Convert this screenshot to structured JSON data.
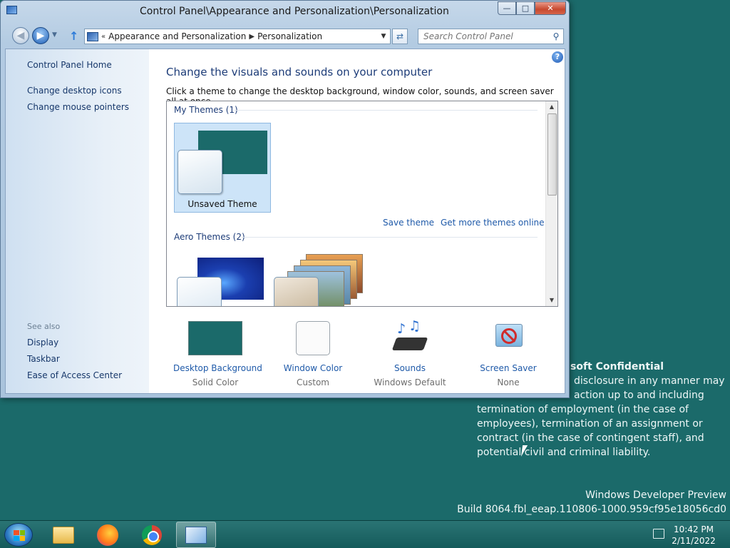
{
  "desktop": {
    "confidential_title": "soft Confidential",
    "confidential_lines": [
      "disclosure in any manner may",
      "action up to and including",
      "termination of employment (in the case of",
      "employees), termination of an assignment or",
      "contract (in the case of contingent staff), and",
      "potential civil and criminal liability."
    ],
    "preview_title": "Windows Developer Preview",
    "build": "Build 8064.fbl_eeap.110806-1000.959cf95e18056cd0"
  },
  "window": {
    "title": "Control Panel\\Appearance and Personalization\\Personalization",
    "buttons": {
      "minimize": "—",
      "maximize": "□",
      "close": "✕"
    }
  },
  "navbar": {
    "breadcrumb": [
      "Appearance and Personalization",
      "Personalization"
    ],
    "search_placeholder": "Search Control Panel"
  },
  "sidebar": {
    "home": "Control Panel Home",
    "links": [
      "Change desktop icons",
      "Change mouse pointers"
    ],
    "see_also_label": "See also",
    "see_also": [
      "Display",
      "Taskbar",
      "Ease of Access Center"
    ]
  },
  "main": {
    "heading": "Change the visuals and sounds on your computer",
    "description": "Click a theme to change the desktop background, window color, sounds, and screen saver all at once.",
    "my_themes_label": "My Themes (1)",
    "unsaved_theme": "Unsaved Theme",
    "save_theme": "Save theme",
    "get_more": "Get more themes online",
    "aero_themes_label": "Aero Themes (2)"
  },
  "bottom": [
    {
      "label": "Desktop Background",
      "value": "Solid Color"
    },
    {
      "label": "Window Color",
      "value": "Custom"
    },
    {
      "label": "Sounds",
      "value": "Windows Default"
    },
    {
      "label": "Screen Saver",
      "value": "None"
    }
  ],
  "taskbar": {
    "time": "10:42 PM",
    "date": "2/11/2022"
  },
  "colors": {
    "desktop": "#1b6a6a",
    "link": "#1f5aa9",
    "heading": "#1d3c78"
  },
  "icons": [
    "start-orb-icon",
    "file-explorer-icon",
    "firefox-icon",
    "chrome-icon",
    "control-panel-icon",
    "action-center-flag-icon",
    "help-icon",
    "search-icon"
  ]
}
